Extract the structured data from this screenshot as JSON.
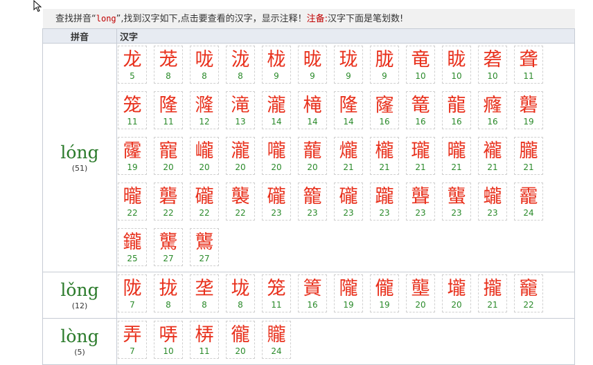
{
  "info": {
    "prefix": "查找拼音“",
    "keyword": "long",
    "middle": "”,找到汉字如下,点击要查看的汉字，显示注释！",
    "note_label": "注备:",
    "note_text": "汉字下面是笔划数!"
  },
  "table": {
    "header_pinyin": "拼音",
    "header_hanzi": "汉字"
  },
  "groups": [
    {
      "pinyin": "lóng",
      "count": "(51)",
      "chars": [
        {
          "c": "龙",
          "s": "5"
        },
        {
          "c": "茏",
          "s": "8"
        },
        {
          "c": "咙",
          "s": "8"
        },
        {
          "c": "泷",
          "s": "8"
        },
        {
          "c": "栊",
          "s": "9"
        },
        {
          "c": "昽",
          "s": "9"
        },
        {
          "c": "珑",
          "s": "9"
        },
        {
          "c": "胧",
          "s": "9"
        },
        {
          "c": "竜",
          "s": "10"
        },
        {
          "c": "眬",
          "s": "10"
        },
        {
          "c": "砻",
          "s": "10"
        },
        {
          "c": "聋",
          "s": "11"
        },
        {
          "c": "笼",
          "s": "11"
        },
        {
          "c": "隆",
          "s": "11"
        },
        {
          "c": "漋",
          "s": "12"
        },
        {
          "c": "滝",
          "s": "13"
        },
        {
          "c": "瀧",
          "s": "14"
        },
        {
          "c": "槞",
          "s": "14"
        },
        {
          "c": "隆",
          "s": "14"
        },
        {
          "c": "窿",
          "s": "16"
        },
        {
          "c": "篭",
          "s": "16"
        },
        {
          "c": "龍",
          "s": "16"
        },
        {
          "c": "癃",
          "s": "16"
        },
        {
          "c": "礱",
          "s": "19"
        },
        {
          "c": "霳",
          "s": "19"
        },
        {
          "c": "寵",
          "s": "20"
        },
        {
          "c": "巄",
          "s": "20"
        },
        {
          "c": "瀧",
          "s": "20"
        },
        {
          "c": "嚨",
          "s": "20"
        },
        {
          "c": "蘢",
          "s": "20"
        },
        {
          "c": "爖",
          "s": "21"
        },
        {
          "c": "櫳",
          "s": "21"
        },
        {
          "c": "瓏",
          "s": "21"
        },
        {
          "c": "曨",
          "s": "21"
        },
        {
          "c": "襱",
          "s": "21"
        },
        {
          "c": "朧",
          "s": "21"
        },
        {
          "c": "曨",
          "s": "22"
        },
        {
          "c": "礱",
          "s": "22"
        },
        {
          "c": "礲",
          "s": "22"
        },
        {
          "c": "襲",
          "s": "22"
        },
        {
          "c": "礲",
          "s": "23"
        },
        {
          "c": "籠",
          "s": "23"
        },
        {
          "c": "礲",
          "s": "23"
        },
        {
          "c": "躘",
          "s": "23"
        },
        {
          "c": "聾",
          "s": "23"
        },
        {
          "c": "蠪",
          "s": "23"
        },
        {
          "c": "蠬",
          "s": "23"
        },
        {
          "c": "靇",
          "s": "24"
        },
        {
          "c": "鑨",
          "s": "25"
        },
        {
          "c": "驡",
          "s": "27"
        },
        {
          "c": "鸗",
          "s": "27"
        }
      ]
    },
    {
      "pinyin": "lǒng",
      "count": "(12)",
      "chars": [
        {
          "c": "陇",
          "s": "7"
        },
        {
          "c": "拢",
          "s": "8"
        },
        {
          "c": "垄",
          "s": "8"
        },
        {
          "c": "垅",
          "s": "8"
        },
        {
          "c": "笼",
          "s": "11"
        },
        {
          "c": "篢",
          "s": "16"
        },
        {
          "c": "隴",
          "s": "19"
        },
        {
          "c": "儱",
          "s": "19"
        },
        {
          "c": "壟",
          "s": "20"
        },
        {
          "c": "壠",
          "s": "20"
        },
        {
          "c": "攏",
          "s": "21"
        },
        {
          "c": "竉",
          "s": "22"
        }
      ]
    },
    {
      "pinyin": "lòng",
      "count": "(5)",
      "chars": [
        {
          "c": "弄",
          "s": "7"
        },
        {
          "c": "哢",
          "s": "10"
        },
        {
          "c": "梇",
          "s": "11"
        },
        {
          "c": "徿",
          "s": "20"
        },
        {
          "c": "贚",
          "s": "24"
        }
      ]
    }
  ]
}
